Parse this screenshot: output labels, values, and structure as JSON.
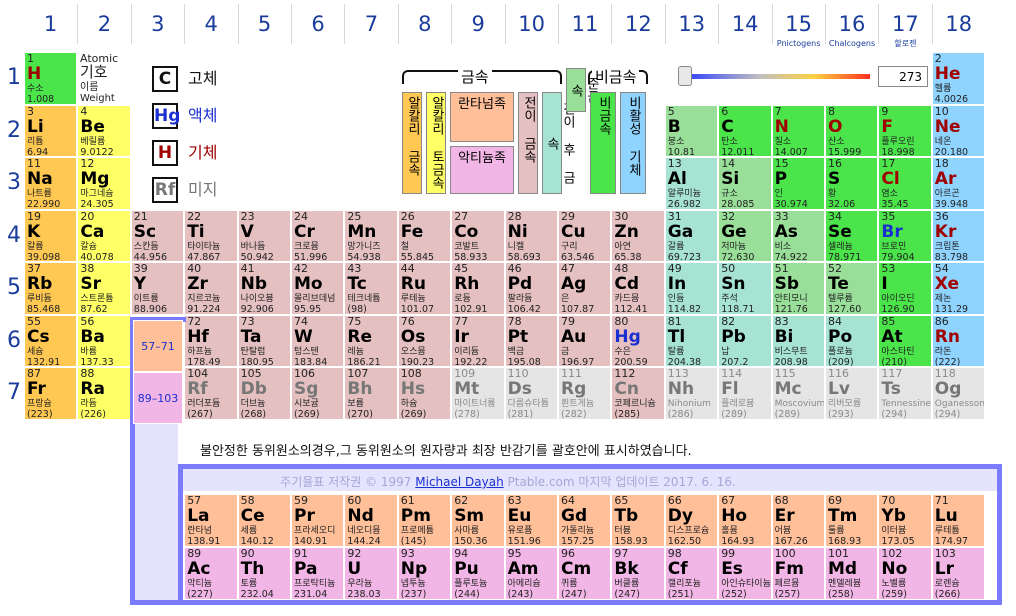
{
  "groups": [
    {
      "num": "1",
      "sub": ""
    },
    {
      "num": "2",
      "sub": ""
    },
    {
      "num": "3",
      "sub": ""
    },
    {
      "num": "4",
      "sub": ""
    },
    {
      "num": "5",
      "sub": ""
    },
    {
      "num": "6",
      "sub": ""
    },
    {
      "num": "7",
      "sub": ""
    },
    {
      "num": "8",
      "sub": ""
    },
    {
      "num": "9",
      "sub": ""
    },
    {
      "num": "10",
      "sub": ""
    },
    {
      "num": "11",
      "sub": ""
    },
    {
      "num": "12",
      "sub": ""
    },
    {
      "num": "13",
      "sub": ""
    },
    {
      "num": "14",
      "sub": ""
    },
    {
      "num": "15",
      "sub": "Pnictogens"
    },
    {
      "num": "16",
      "sub": "Chalcogens"
    },
    {
      "num": "17",
      "sub": "할로젠"
    },
    {
      "num": "18",
      "sub": ""
    }
  ],
  "periods": [
    "1",
    "2",
    "3",
    "4",
    "5",
    "6",
    "7"
  ],
  "atomic_key": {
    "number": "Atomic",
    "name": "기호",
    "korean": "이름",
    "weight": "Weight"
  },
  "state_legend": [
    {
      "symbol": "C",
      "label": "고체",
      "state": "solid",
      "color": "#111111"
    },
    {
      "symbol": "Hg",
      "label": "액체",
      "state": "liquid",
      "color": "#1a2fd0"
    },
    {
      "symbol": "H",
      "label": "기체",
      "state": "gas",
      "color": "#a00000"
    },
    {
      "symbol": "Rf",
      "label": "미지",
      "state": "unknown",
      "color": "#777777"
    }
  ],
  "category_legend": {
    "metals_label": "금속",
    "nonmetals_label": "비금속",
    "items": [
      {
        "label": "알칼리 금속",
        "cls": "c-alkali"
      },
      {
        "label": "알칼리 토금속",
        "cls": "c-alkearth"
      },
      {
        "label": "란타넘족",
        "cls": "c-lanth"
      },
      {
        "label": "악티늄족",
        "cls": "c-actin"
      },
      {
        "label": "전이 금속",
        "cls": "c-trans"
      },
      {
        "label": "전이 후 금속",
        "cls": "c-post"
      },
      {
        "label": "준금속",
        "cls": "c-metalloid"
      },
      {
        "label": "비금속",
        "cls": "c-nonmetal"
      },
      {
        "label": "비활성 기체",
        "cls": "c-noble"
      }
    ]
  },
  "temperature": {
    "value": "273",
    "slider_fraction": 0.0
  },
  "lanthanide_range": "57–71",
  "actinide_range": "89–103",
  "note": "불안정한 동위원소의경우,그 동위원소의 원자량과 최장 반감기를 괄호안에 표시하였습니다.",
  "copyright": {
    "prefix": "주기율표 저작권 © 1997 ",
    "author": "Michael Dayah",
    "suffix": " Ptable.com 마지막 업데이트 2017. 6. 16."
  },
  "elements": [
    [
      "1",
      "H",
      "수소",
      "1.008",
      1,
      1,
      "c-nonmetal",
      "gas"
    ],
    [
      "2",
      "He",
      "헬륨",
      "4.0026",
      18,
      1,
      "c-noble",
      "gas"
    ],
    [
      "3",
      "Li",
      "리튬",
      "6.94",
      1,
      2,
      "c-alkali",
      ""
    ],
    [
      "4",
      "Be",
      "베릴륨",
      "9.0122",
      2,
      2,
      "c-alkearth",
      ""
    ],
    [
      "5",
      "B",
      "붕소",
      "10.81",
      13,
      2,
      "c-metalloid",
      ""
    ],
    [
      "6",
      "C",
      "탄소",
      "12.011",
      14,
      2,
      "c-nonmetal",
      ""
    ],
    [
      "7",
      "N",
      "질소",
      "14.007",
      15,
      2,
      "c-nonmetal",
      "gas"
    ],
    [
      "8",
      "O",
      "산소",
      "15.999",
      16,
      2,
      "c-nonmetal",
      "gas"
    ],
    [
      "9",
      "F",
      "플루오린",
      "18.998",
      17,
      2,
      "c-halogen",
      "gas"
    ],
    [
      "10",
      "Ne",
      "네온",
      "20.180",
      18,
      2,
      "c-noble",
      "gas"
    ],
    [
      "11",
      "Na",
      "나트륨",
      "22.990",
      1,
      3,
      "c-alkali",
      ""
    ],
    [
      "12",
      "Mg",
      "마그네슘",
      "24.305",
      2,
      3,
      "c-alkearth",
      ""
    ],
    [
      "13",
      "Al",
      "알루미늄",
      "26.982",
      13,
      3,
      "c-post",
      ""
    ],
    [
      "14",
      "Si",
      "규소",
      "28.085",
      14,
      3,
      "c-metalloid",
      ""
    ],
    [
      "15",
      "P",
      "인",
      "30.974",
      15,
      3,
      "c-nonmetal",
      ""
    ],
    [
      "16",
      "S",
      "황",
      "32.06",
      16,
      3,
      "c-nonmetal",
      ""
    ],
    [
      "17",
      "Cl",
      "염소",
      "35.45",
      17,
      3,
      "c-halogen",
      "gas"
    ],
    [
      "18",
      "Ar",
      "아르곤",
      "39.948",
      18,
      3,
      "c-noble",
      "gas"
    ],
    [
      "19",
      "K",
      "칼륨",
      "39.098",
      1,
      4,
      "c-alkali",
      ""
    ],
    [
      "20",
      "Ca",
      "칼슘",
      "40.078",
      2,
      4,
      "c-alkearth",
      ""
    ],
    [
      "21",
      "Sc",
      "스칸듐",
      "44.956",
      3,
      4,
      "c-trans",
      ""
    ],
    [
      "22",
      "Ti",
      "타이타늄",
      "47.867",
      4,
      4,
      "c-trans",
      ""
    ],
    [
      "23",
      "V",
      "바나듐",
      "50.942",
      5,
      4,
      "c-trans",
      ""
    ],
    [
      "24",
      "Cr",
      "크로뮴",
      "51.996",
      6,
      4,
      "c-trans",
      ""
    ],
    [
      "25",
      "Mn",
      "망가니즈",
      "54.938",
      7,
      4,
      "c-trans",
      ""
    ],
    [
      "26",
      "Fe",
      "철",
      "55.845",
      8,
      4,
      "c-trans",
      ""
    ],
    [
      "27",
      "Co",
      "코발트",
      "58.933",
      9,
      4,
      "c-trans",
      ""
    ],
    [
      "28",
      "Ni",
      "니켈",
      "58.693",
      10,
      4,
      "c-trans",
      ""
    ],
    [
      "29",
      "Cu",
      "구리",
      "63.546",
      11,
      4,
      "c-trans",
      ""
    ],
    [
      "30",
      "Zn",
      "아연",
      "65.38",
      12,
      4,
      "c-trans",
      ""
    ],
    [
      "31",
      "Ga",
      "갈륨",
      "69.723",
      13,
      4,
      "c-post",
      ""
    ],
    [
      "32",
      "Ge",
      "저마늄",
      "72.630",
      14,
      4,
      "c-metalloid",
      ""
    ],
    [
      "33",
      "As",
      "비소",
      "74.922",
      15,
      4,
      "c-metalloid",
      ""
    ],
    [
      "34",
      "Se",
      "셀레늄",
      "78.971",
      16,
      4,
      "c-nonmetal",
      ""
    ],
    [
      "35",
      "Br",
      "브로민",
      "79.904",
      17,
      4,
      "c-halogen",
      "liq"
    ],
    [
      "36",
      "Kr",
      "크립톤",
      "83.798",
      18,
      4,
      "c-noble",
      "gas"
    ],
    [
      "37",
      "Rb",
      "루비듐",
      "85.468",
      1,
      5,
      "c-alkali",
      ""
    ],
    [
      "38",
      "Sr",
      "스트론튬",
      "87.62",
      2,
      5,
      "c-alkearth",
      ""
    ],
    [
      "39",
      "Y",
      "이트륨",
      "88.906",
      3,
      5,
      "c-trans",
      ""
    ],
    [
      "40",
      "Zr",
      "지르코늄",
      "91.224",
      4,
      5,
      "c-trans",
      ""
    ],
    [
      "41",
      "Nb",
      "나이오븀",
      "92.906",
      5,
      5,
      "c-trans",
      ""
    ],
    [
      "42",
      "Mo",
      "몰리브데넘",
      "95.95",
      6,
      5,
      "c-trans",
      ""
    ],
    [
      "43",
      "Tc",
      "테크네튬",
      "(98)",
      7,
      5,
      "c-trans",
      ""
    ],
    [
      "44",
      "Ru",
      "루테늄",
      "101.07",
      8,
      5,
      "c-trans",
      ""
    ],
    [
      "45",
      "Rh",
      "로듐",
      "102.91",
      9,
      5,
      "c-trans",
      ""
    ],
    [
      "46",
      "Pd",
      "팔라듐",
      "106.42",
      10,
      5,
      "c-trans",
      ""
    ],
    [
      "47",
      "Ag",
      "은",
      "107.87",
      11,
      5,
      "c-trans",
      ""
    ],
    [
      "48",
      "Cd",
      "카드뮴",
      "112.41",
      12,
      5,
      "c-trans",
      ""
    ],
    [
      "49",
      "In",
      "인듐",
      "114.82",
      13,
      5,
      "c-post",
      ""
    ],
    [
      "50",
      "Sn",
      "주석",
      "118.71",
      14,
      5,
      "c-post",
      ""
    ],
    [
      "51",
      "Sb",
      "안티모니",
      "121.76",
      15,
      5,
      "c-metalloid",
      ""
    ],
    [
      "52",
      "Te",
      "텔루륨",
      "127.60",
      16,
      5,
      "c-metalloid",
      ""
    ],
    [
      "53",
      "I",
      "아이오딘",
      "126.90",
      17,
      5,
      "c-halogen",
      ""
    ],
    [
      "54",
      "Xe",
      "제논",
      "131.29",
      18,
      5,
      "c-noble",
      "gas"
    ],
    [
      "55",
      "Cs",
      "세슘",
      "132.91",
      1,
      6,
      "c-alkali",
      ""
    ],
    [
      "56",
      "Ba",
      "바륨",
      "137.33",
      2,
      6,
      "c-alkearth",
      ""
    ],
    [
      "72",
      "Hf",
      "하프늄",
      "178.49",
      4,
      6,
      "c-trans",
      ""
    ],
    [
      "73",
      "Ta",
      "탄탈럼",
      "180.95",
      5,
      6,
      "c-trans",
      ""
    ],
    [
      "74",
      "W",
      "텅스텐",
      "183.84",
      6,
      6,
      "c-trans",
      ""
    ],
    [
      "75",
      "Re",
      "레늄",
      "186.21",
      7,
      6,
      "c-trans",
      ""
    ],
    [
      "76",
      "Os",
      "오스뮴",
      "190.23",
      8,
      6,
      "c-trans",
      ""
    ],
    [
      "77",
      "Ir",
      "이리듐",
      "192.22",
      9,
      6,
      "c-trans",
      ""
    ],
    [
      "78",
      "Pt",
      "백금",
      "195.08",
      10,
      6,
      "c-trans",
      ""
    ],
    [
      "79",
      "Au",
      "금",
      "196.97",
      11,
      6,
      "c-trans",
      ""
    ],
    [
      "80",
      "Hg",
      "수은",
      "200.59",
      12,
      6,
      "c-trans",
      "liq"
    ],
    [
      "81",
      "Tl",
      "탈륨",
      "204.38",
      13,
      6,
      "c-post",
      ""
    ],
    [
      "82",
      "Pb",
      "납",
      "207.2",
      14,
      6,
      "c-post",
      ""
    ],
    [
      "83",
      "Bi",
      "비스무트",
      "208.98",
      15,
      6,
      "c-post",
      ""
    ],
    [
      "84",
      "Po",
      "폴로늄",
      "(209)",
      16,
      6,
      "c-post",
      ""
    ],
    [
      "85",
      "At",
      "아스타틴",
      "(210)",
      17,
      6,
      "c-halogen",
      ""
    ],
    [
      "86",
      "Rn",
      "라돈",
      "(222)",
      18,
      6,
      "c-noble",
      "gas"
    ],
    [
      "87",
      "Fr",
      "프랑슘",
      "(223)",
      1,
      7,
      "c-alkali",
      ""
    ],
    [
      "88",
      "Ra",
      "라듐",
      "(226)",
      2,
      7,
      "c-alkearth",
      ""
    ],
    [
      "104",
      "Rf",
      "러더포듐",
      "(267)",
      4,
      7,
      "c-trans",
      "syn"
    ],
    [
      "105",
      "Db",
      "더브늄",
      "(268)",
      5,
      7,
      "c-trans",
      "syn"
    ],
    [
      "106",
      "Sg",
      "시보귬",
      "(269)",
      6,
      7,
      "c-trans",
      "syn"
    ],
    [
      "107",
      "Bh",
      "보륨",
      "(270)",
      7,
      7,
      "c-trans",
      "syn"
    ],
    [
      "108",
      "Hs",
      "하슘",
      "(269)",
      8,
      7,
      "c-trans",
      "syn"
    ],
    [
      "109",
      "Mt",
      "마이트너륨",
      "(278)",
      9,
      7,
      "c-unknown",
      "syn"
    ],
    [
      "110",
      "Ds",
      "다름슈타튬",
      "(281)",
      10,
      7,
      "c-unknown",
      "syn"
    ],
    [
      "111",
      "Rg",
      "뢴트게늄",
      "(282)",
      11,
      7,
      "c-unknown",
      "syn"
    ],
    [
      "112",
      "Cn",
      "코페르니슘",
      "(285)",
      12,
      7,
      "c-trans",
      "syn"
    ],
    [
      "113",
      "Nh",
      "Nihonium",
      "(286)",
      13,
      7,
      "c-unknown",
      "syn"
    ],
    [
      "114",
      "Fl",
      "플레로븀",
      "(289)",
      14,
      7,
      "c-unknown",
      "syn"
    ],
    [
      "115",
      "Mc",
      "Moscovium",
      "(289)",
      15,
      7,
      "c-unknown",
      "syn"
    ],
    [
      "116",
      "Lv",
      "리버모륨",
      "(293)",
      16,
      7,
      "c-unknown",
      "syn"
    ],
    [
      "117",
      "Ts",
      "Tennessine",
      "(294)",
      17,
      7,
      "c-unknown",
      "syn"
    ],
    [
      "118",
      "Og",
      "Oganesson",
      "(294)",
      18,
      7,
      "c-unknown",
      "syn"
    ]
  ],
  "lanthanides": [
    [
      "57",
      "La",
      "란타넘",
      "138.91"
    ],
    [
      "58",
      "Ce",
      "세륨",
      "140.12"
    ],
    [
      "59",
      "Pr",
      "프라세오디",
      "140.91"
    ],
    [
      "60",
      "Nd",
      "네오디뮴",
      "144.24"
    ],
    [
      "61",
      "Pm",
      "프로메튬",
      "(145)"
    ],
    [
      "62",
      "Sm",
      "사마륨",
      "150.36"
    ],
    [
      "63",
      "Eu",
      "유로퓸",
      "151.96"
    ],
    [
      "64",
      "Gd",
      "가돌리늄",
      "157.25"
    ],
    [
      "65",
      "Tb",
      "터븀",
      "158.93"
    ],
    [
      "66",
      "Dy",
      "디스프로슘",
      "162.50"
    ],
    [
      "67",
      "Ho",
      "홀뮴",
      "164.93"
    ],
    [
      "68",
      "Er",
      "어븀",
      "167.26"
    ],
    [
      "69",
      "Tm",
      "툴륨",
      "168.93"
    ],
    [
      "70",
      "Yb",
      "이터븀",
      "173.05"
    ],
    [
      "71",
      "Lu",
      "루테튬",
      "174.97"
    ]
  ],
  "actinides": [
    [
      "89",
      "Ac",
      "악티늄",
      "(227)"
    ],
    [
      "90",
      "Th",
      "토륨",
      "232.04"
    ],
    [
      "91",
      "Pa",
      "프로탁티늄",
      "231.04"
    ],
    [
      "92",
      "U",
      "우라늄",
      "238.03"
    ],
    [
      "93",
      "Np",
      "넵투늄",
      "(237)"
    ],
    [
      "94",
      "Pu",
      "플루토늄",
      "(244)"
    ],
    [
      "95",
      "Am",
      "아메리슘",
      "(243)"
    ],
    [
      "96",
      "Cm",
      "퀴륨",
      "(247)"
    ],
    [
      "97",
      "Bk",
      "버클륨",
      "(247)"
    ],
    [
      "98",
      "Cf",
      "캘리포늄",
      "(251)"
    ],
    [
      "99",
      "Es",
      "아인슈타이늄",
      "(252)"
    ],
    [
      "100",
      "Fm",
      "페르뮴",
      "(257)"
    ],
    [
      "101",
      "Md",
      "멘델레븀",
      "(258)"
    ],
    [
      "102",
      "No",
      "노벨륨",
      "(259)"
    ],
    [
      "103",
      "Lr",
      "로렌슘",
      "(266)"
    ]
  ],
  "colors": {
    "accent": "#7b7bff",
    "header_text": "#1a3d9c"
  }
}
